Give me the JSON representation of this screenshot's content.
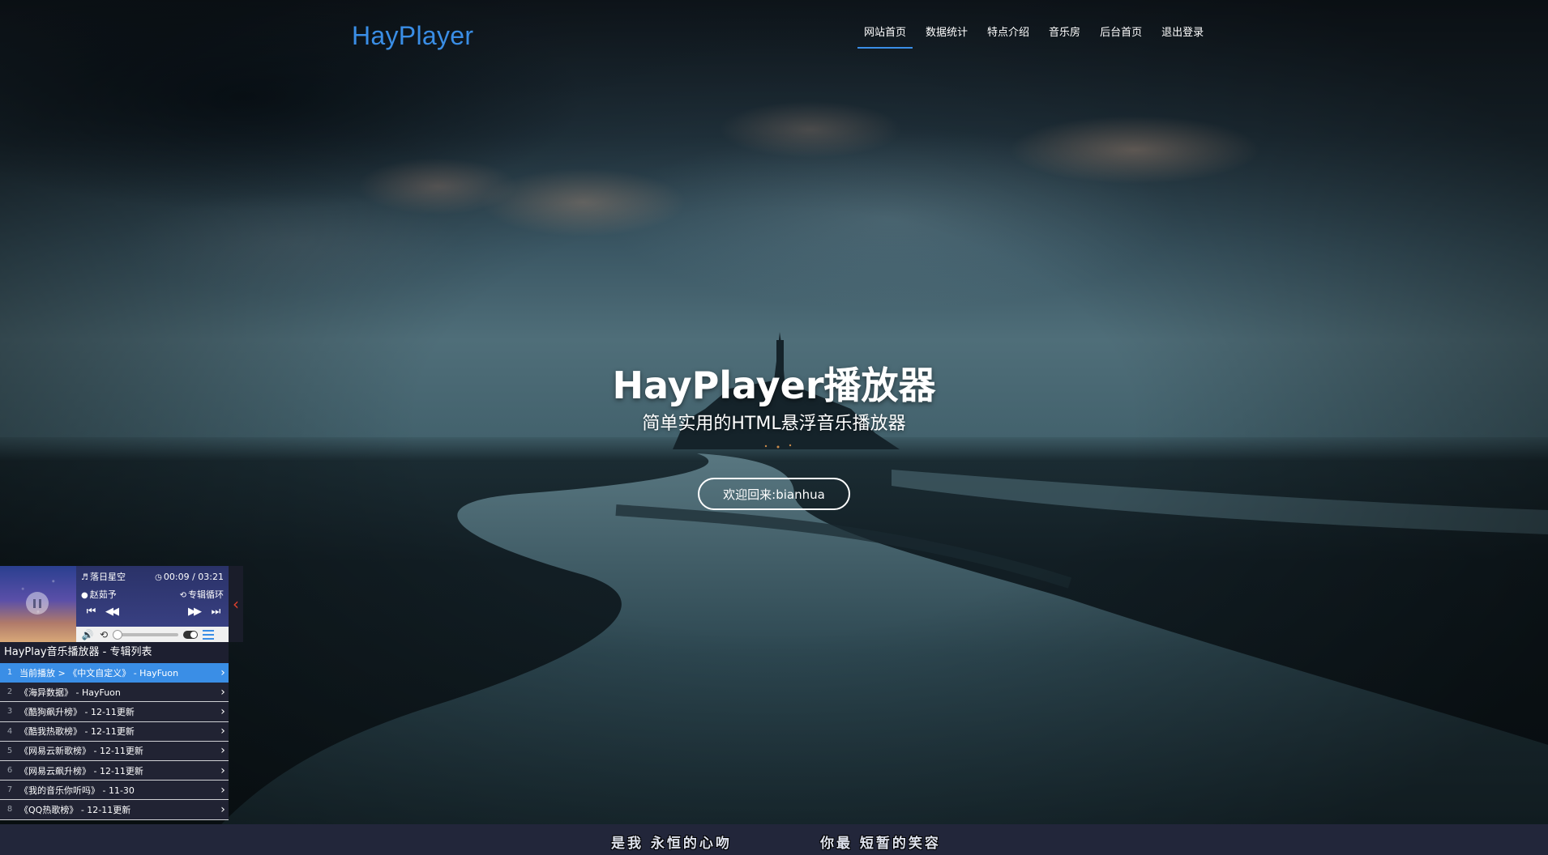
{
  "brand": {
    "logo": "HayPlayer",
    "accent": "#3a8ee6"
  },
  "nav": {
    "items": [
      {
        "label": "网站首页",
        "active": true
      },
      {
        "label": "数据统计"
      },
      {
        "label": "特点介绍"
      },
      {
        "label": "音乐房"
      },
      {
        "label": "后台首页"
      },
      {
        "label": "退出登录"
      }
    ]
  },
  "hero": {
    "title": "HayPlayer播放器",
    "subtitle": "简单实用的HTML悬浮音乐播放器",
    "welcome_button": "欢迎回来:bianhua"
  },
  "player": {
    "song": "落日星空",
    "time": "00:09 / 03:21",
    "artist": "赵茹予",
    "mode": "专辑循环",
    "icons": {
      "song": "music-note-icon",
      "time": "clock-icon",
      "artist": "user-icon",
      "mode": "repeat-icon"
    },
    "collapse_color": "#e0412c"
  },
  "playlist": {
    "title": "HayPlay音乐播放器 - 专辑列表",
    "items": [
      {
        "num": "1",
        "text": "当前播放 > 《中文自定义》 - HayFuon",
        "active": true
      },
      {
        "num": "2",
        "text": "《海异数据》 - HayFuon"
      },
      {
        "num": "3",
        "text": "《酷狗飙升榜》 - 12-11更新"
      },
      {
        "num": "4",
        "text": "《酷我热歌榜》 - 12-11更新"
      },
      {
        "num": "5",
        "text": "《网易云新歌榜》 - 12-11更新"
      },
      {
        "num": "6",
        "text": "《网易云飙升榜》 - 12-11更新"
      },
      {
        "num": "7",
        "text": "《我的音乐你听吗》 - 11-30"
      },
      {
        "num": "8",
        "text": "《QQ热歌榜》 - 12-11更新"
      }
    ]
  },
  "lyrics": {
    "left": "是我 永恒的心吻",
    "right": "你最 短暂的笑容"
  }
}
